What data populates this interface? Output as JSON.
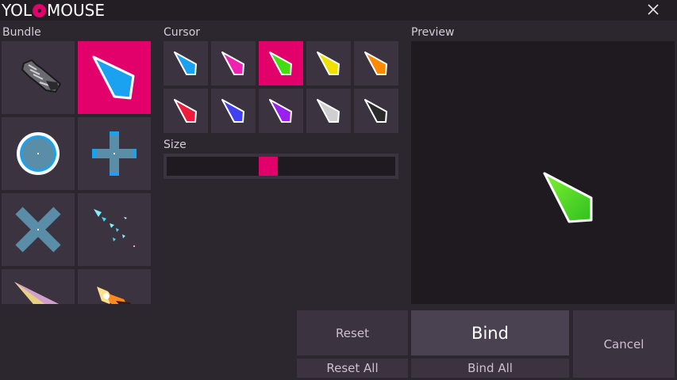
{
  "app": {
    "title_part1": "YOL",
    "title_part2": "MOUSE"
  },
  "window": {
    "close_label": "×"
  },
  "sections": {
    "bundle": "Bundle",
    "cursor": "Cursor",
    "size": "Size",
    "preview": "Preview"
  },
  "bundle": {
    "items": [
      {
        "id": "gauntlet",
        "selected": false
      },
      {
        "id": "arrow-blue",
        "selected": true
      },
      {
        "id": "circle",
        "selected": false
      },
      {
        "id": "cross-plus",
        "selected": false
      },
      {
        "id": "cross-x",
        "selected": false
      },
      {
        "id": "sparkle",
        "selected": false
      },
      {
        "id": "golden-arrow",
        "selected": false
      },
      {
        "id": "fire",
        "selected": false
      }
    ]
  },
  "cursor": {
    "selected_index": 2,
    "colors": [
      "#1aa2f0",
      "#f020b0",
      "#44dd10",
      "#f0e000",
      "#ff8a00",
      "#f01a3a",
      "#4040f5",
      "#9a20f0",
      "#cfcfcf",
      "#2a2a2a"
    ]
  },
  "size": {
    "value_fraction": 0.44
  },
  "preview": {
    "cursor_color": "#44dd10"
  },
  "buttons": {
    "reset": "Reset",
    "reset_all": "Reset All",
    "bind": "Bind",
    "bind_all": "Bind All",
    "cancel": "Cancel"
  },
  "colors": {
    "accent": "#e2006a",
    "tile": "#3b3440",
    "background": "#2c272e"
  }
}
